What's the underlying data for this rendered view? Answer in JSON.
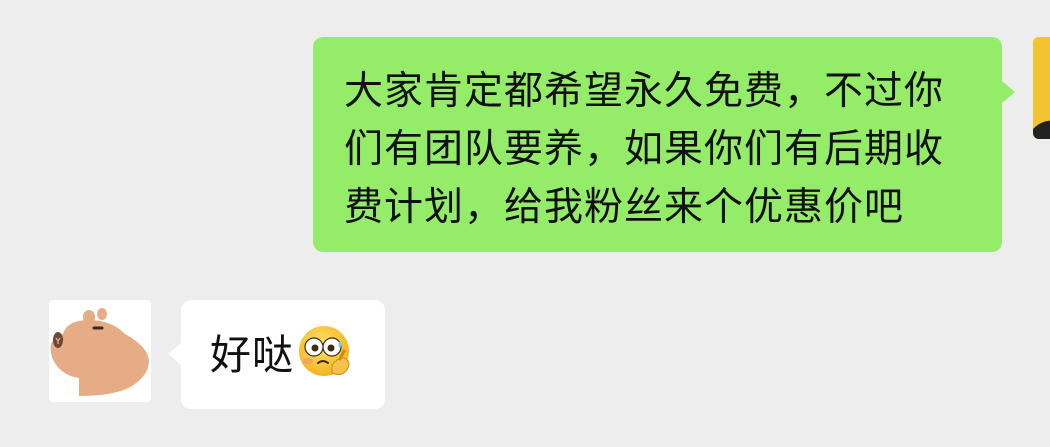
{
  "chat": {
    "messages": [
      {
        "side": "outgoing",
        "text": "大家肯定都希望永久免费，不过你们有团队要养，如果你们有后期收费计划，给我粉丝来个优惠价吧",
        "bubble_color": "#95ec69"
      },
      {
        "side": "incoming",
        "text": "好哒",
        "emoji": "face-holding-back-tears-emoji",
        "bubble_color": "#ffffff"
      }
    ],
    "self_avatar": "self-avatar",
    "other_avatar": "capybara-avatar"
  },
  "colors": {
    "background": "#ededed",
    "outgoing_bubble": "#95ec69",
    "incoming_bubble": "#ffffff",
    "text": "#111111"
  }
}
